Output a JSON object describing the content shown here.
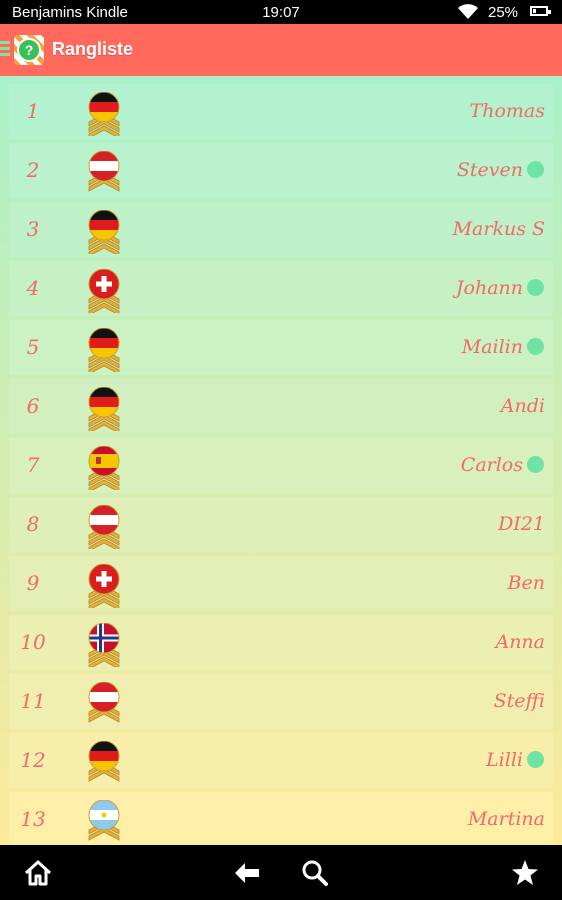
{
  "status_bar": {
    "carrier": "Benjamins Kindle",
    "time": "19:07",
    "battery": "25%",
    "battery_level": 0.25
  },
  "app_bar": {
    "title": "Rangliste",
    "logo_glyph": "?"
  },
  "ranking": [
    {
      "rank": "1",
      "name": "Thomas",
      "flag": "germany",
      "chevrons": 3,
      "online": false
    },
    {
      "rank": "2",
      "name": "Steven",
      "flag": "austria",
      "chevrons": 2,
      "online": true
    },
    {
      "rank": "3",
      "name": "Markus S",
      "flag": "germany",
      "chevrons": 3,
      "online": false
    },
    {
      "rank": "4",
      "name": "Johann",
      "flag": "switzerland",
      "chevrons": 3,
      "online": true
    },
    {
      "rank": "5",
      "name": "Mailin",
      "flag": "germany",
      "chevrons": 3,
      "online": true
    },
    {
      "rank": "6",
      "name": "Andi",
      "flag": "germany",
      "chevrons": 3,
      "online": false
    },
    {
      "rank": "7",
      "name": "Carlos",
      "flag": "spain",
      "chevrons": 3,
      "online": true
    },
    {
      "rank": "8",
      "name": "DI21",
      "flag": "austria",
      "chevrons": 3,
      "online": false
    },
    {
      "rank": "9",
      "name": "Ben",
      "flag": "switzerland",
      "chevrons": 3,
      "online": false
    },
    {
      "rank": "10",
      "name": "Anna",
      "flag": "norway",
      "chevrons": 3,
      "online": false
    },
    {
      "rank": "11",
      "name": "Steffi",
      "flag": "austria",
      "chevrons": 2,
      "online": false
    },
    {
      "rank": "12",
      "name": "Lilli",
      "flag": "germany",
      "chevrons": 2,
      "online": true
    },
    {
      "rank": "13",
      "name": "Martina",
      "flag": "argentina",
      "chevrons": 2,
      "online": false
    }
  ],
  "colors": {
    "app_bar": "#ff6a5c",
    "text": "#f26a6a",
    "online_dot": "#6ee3a4",
    "row_top": "#b3f2cf",
    "row_bottom": "#fdeea8",
    "gold": "#e2b13c"
  },
  "nav_bar": {
    "home_icon": "home-icon",
    "back_icon": "back-arrow-icon",
    "search_icon": "search-icon",
    "favorite_icon": "star-icon"
  }
}
